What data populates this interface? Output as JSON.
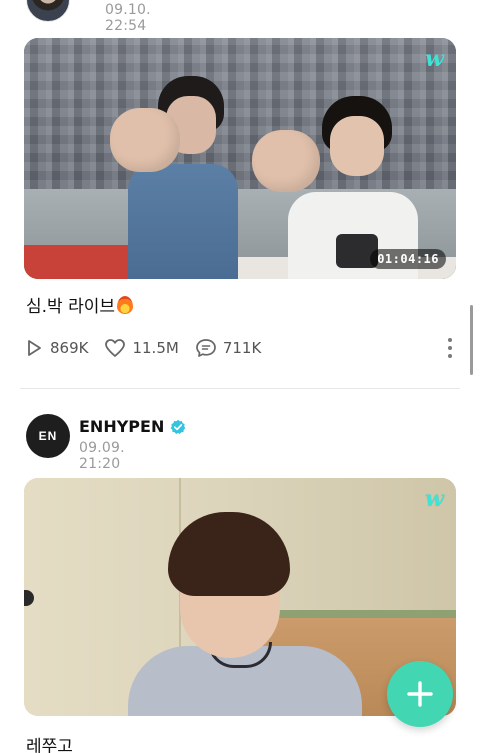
{
  "posts": [
    {
      "time": "09.10. 22:54",
      "media": {
        "weverse_logo": "w",
        "duration": "01:04:16",
        "kind": "live-video-thumbnail"
      },
      "caption": "심.박 라이브",
      "caption_emoji": "fire-icon",
      "stats": {
        "views": "869K",
        "likes": "11.5M",
        "comments": "711K"
      }
    },
    {
      "author": "ENHYPEN",
      "avatar_text": "EN",
      "verified": true,
      "time": "09.09. 21:20",
      "media": {
        "weverse_logo": "w",
        "kind": "live-video-thumbnail"
      },
      "caption": "레쭈고"
    }
  ],
  "fab": {
    "icon": "plus-icon"
  },
  "colors": {
    "accent": "#42d6b3",
    "verified": "#34c3e0",
    "weverse_mark": "#3ee3d6",
    "muted_text": "#9a9a9a"
  }
}
